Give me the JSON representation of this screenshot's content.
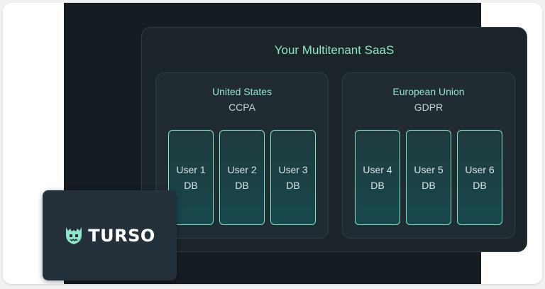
{
  "diagram": {
    "title": "Your Multitenant SaaS",
    "regions": [
      {
        "name": "United States",
        "law": "CCPA",
        "databases": [
          {
            "line1": "User 1",
            "line2": "DB"
          },
          {
            "line1": "User 2",
            "line2": "DB"
          },
          {
            "line1": "User 3",
            "line2": "DB"
          }
        ]
      },
      {
        "name": "European Union",
        "law": "GDPR",
        "databases": [
          {
            "line1": "User 4",
            "line2": "DB"
          },
          {
            "line1": "User 5",
            "line2": "DB"
          },
          {
            "line1": "User 6",
            "line2": "DB"
          }
        ]
      }
    ]
  },
  "brand": {
    "wordmark": "TURSO",
    "icon": "turso-creature-icon",
    "accent_color": "#8ee6c8"
  }
}
